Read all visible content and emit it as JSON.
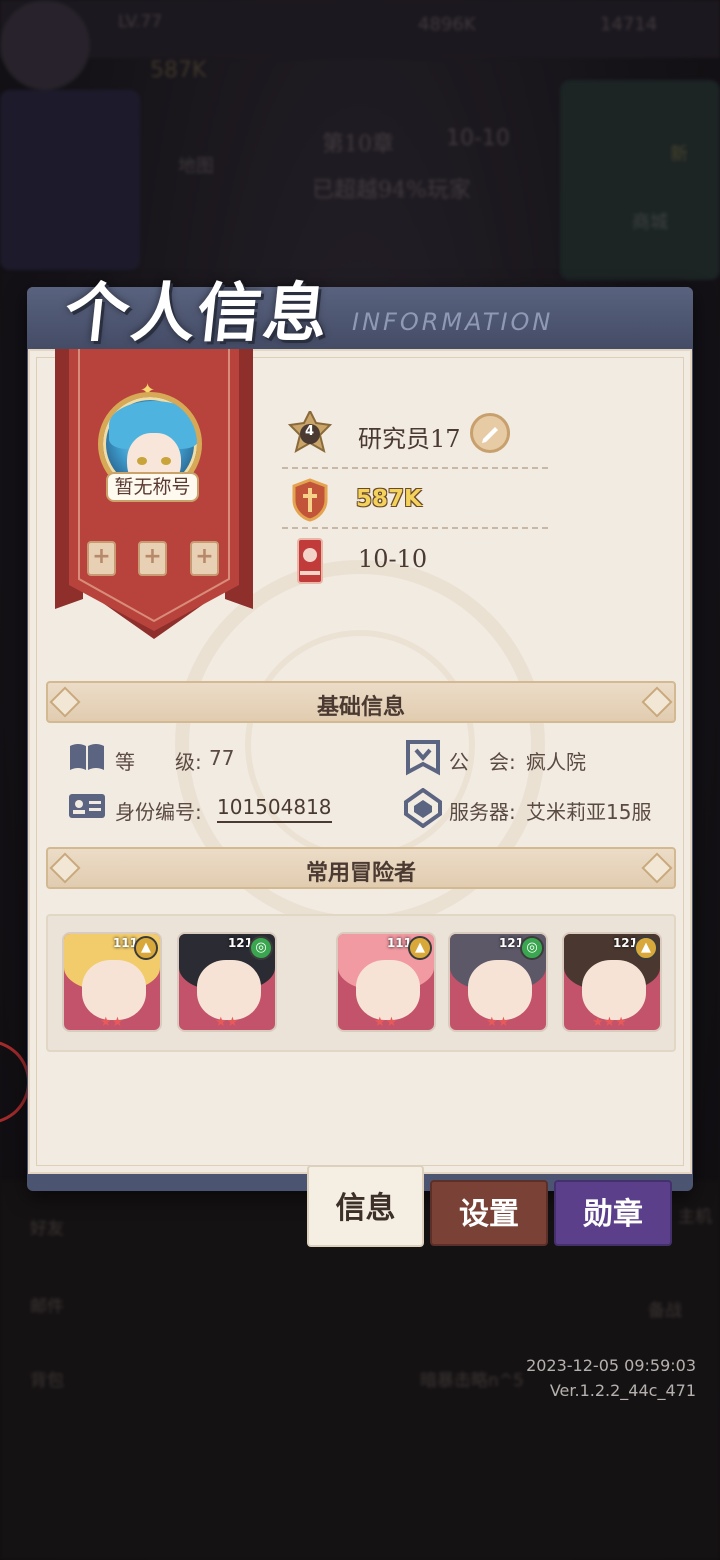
{
  "background": {
    "top_bar": {
      "level": "LV.77",
      "stat1": "4896K",
      "stat2": "14714",
      "power": "587K"
    },
    "map_label": "地图",
    "chapter": "第10章",
    "stage": "10-10",
    "rank_text": "已超越94%玩家",
    "shop_label": "商城",
    "new_badge": "新",
    "left_menu": [
      "好友",
      "邮件",
      "背包"
    ],
    "right_menu": [
      "主机",
      "备战"
    ],
    "chat_preview": "暗暴击略n^5"
  },
  "panel": {
    "title": "个人信息",
    "subtitle": "INFORMATION"
  },
  "profile": {
    "title_tag": "暂无称号",
    "badge_level": "4",
    "name": "研究员17",
    "power": "587K",
    "stage": "10-10",
    "slots": [
      "+",
      "+",
      "+"
    ]
  },
  "basic_info": {
    "header": "基础信息",
    "level_label": "等　　级:",
    "level_value": "77",
    "guild_label": "公　会:",
    "guild_value": "疯人院",
    "id_label": "身份编号:",
    "id_value": "101504818",
    "server_label": "服务器:",
    "server_value": "艾米莉亚15服"
  },
  "adventurers": {
    "header": "常用冒险者",
    "cards": [
      {
        "level": "111",
        "element": "light",
        "stars": "★★",
        "hair": "#f2cc6a"
      },
      {
        "level": "121",
        "element": "wind",
        "stars": "★★",
        "hair": "#2b2b33"
      },
      {
        "level": "111",
        "element": "light",
        "stars": "★★",
        "hair": "#f19aa2"
      },
      {
        "level": "121",
        "element": "wind",
        "stars": "★★",
        "hair": "#5d5868"
      },
      {
        "level": "121",
        "element": "light",
        "stars": "★★★",
        "hair": "#4a3730"
      }
    ]
  },
  "tabs": {
    "info": "信息",
    "settings": "设置",
    "medals": "勋章"
  },
  "footer": {
    "timestamp": "2023-12-05 09:59:03",
    "version": "Ver.1.2.2_44c_471"
  },
  "colors": {
    "panel_frame": "#4b5470",
    "paper": "#f2ebe1",
    "banner_red": "#b8433c",
    "tab_settings": "#7a4237",
    "tab_medals": "#5b3f8a",
    "power_gold": "#f4d35c"
  }
}
